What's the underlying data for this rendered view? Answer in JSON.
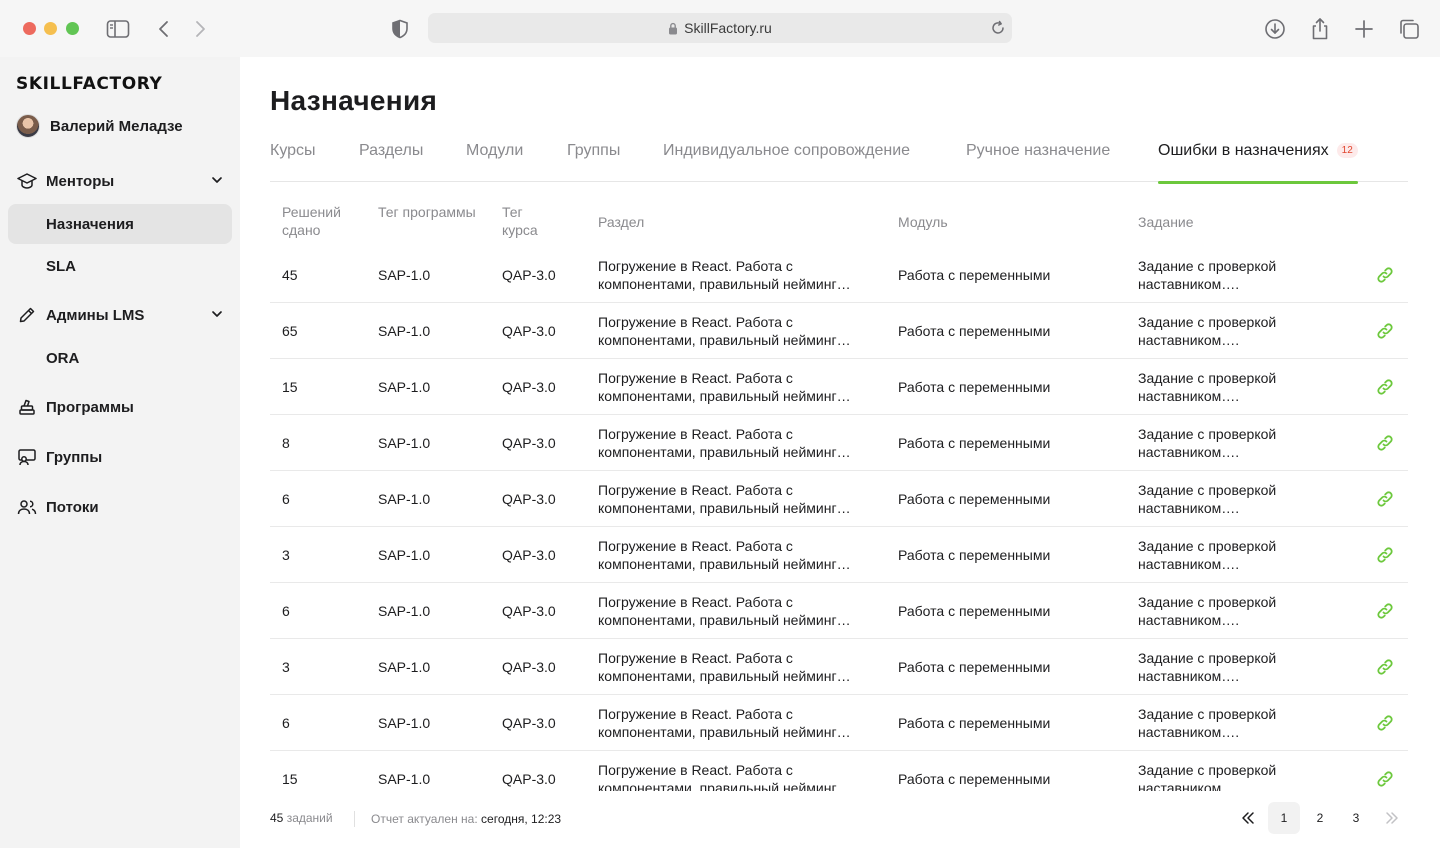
{
  "browser": {
    "url": "SkillFactory.ru"
  },
  "sidebar": {
    "logo": "SKILLFACTORY",
    "user_name": "Валерий Меладзе",
    "sections": {
      "mentors": {
        "label": "Менторы"
      },
      "mentors_items": [
        {
          "label": "Назначения"
        },
        {
          "label": "SLA"
        }
      ],
      "admins": {
        "label": "Админы LMS"
      },
      "admins_items": [
        {
          "label": "ORA"
        }
      ],
      "programs": {
        "label": "Программы"
      },
      "groups": {
        "label": "Группы"
      },
      "streams": {
        "label": "Потоки"
      }
    }
  },
  "main": {
    "title": "Назначения",
    "tabs": [
      {
        "label": "Курсы"
      },
      {
        "label": "Разделы"
      },
      {
        "label": "Модули"
      },
      {
        "label": "Группы"
      },
      {
        "label": "Индивидуальное сопровождение"
      },
      {
        "label": "Ручное назначение"
      },
      {
        "label": "Ошибки в назначениях",
        "badge": "12",
        "active": true
      }
    ],
    "table": {
      "headers": {
        "solved": "Решений сдано",
        "program_tag": "Тег программы",
        "course_tag": "Тег курса",
        "section": "Раздел",
        "module": "Модуль",
        "task": "Задание"
      },
      "rows": [
        {
          "solved": "45",
          "program_tag": "SAP-1.0",
          "course_tag": "QAP-3.0",
          "section": "Погружение в React. Работа с компонентами, правильный нейминг…",
          "module": "Работа с переменными",
          "task": "Задание с проверкой наставником…."
        },
        {
          "solved": "65",
          "program_tag": "SAP-1.0",
          "course_tag": "QAP-3.0",
          "section": "Погружение в React. Работа с компонентами, правильный нейминг…",
          "module": "Работа с переменными",
          "task": "Задание с проверкой наставником…."
        },
        {
          "solved": "15",
          "program_tag": "SAP-1.0",
          "course_tag": "QAP-3.0",
          "section": "Погружение в React. Работа с компонентами, правильный нейминг…",
          "module": "Работа с переменными",
          "task": "Задание с проверкой наставником…."
        },
        {
          "solved": "8",
          "program_tag": "SAP-1.0",
          "course_tag": "QAP-3.0",
          "section": "Погружение в React. Работа с компонентами, правильный нейминг…",
          "module": "Работа с переменными",
          "task": "Задание с проверкой наставником…."
        },
        {
          "solved": "6",
          "program_tag": "SAP-1.0",
          "course_tag": "QAP-3.0",
          "section": "Погружение в React. Работа с компонентами, правильный нейминг…",
          "module": "Работа с переменными",
          "task": "Задание с проверкой наставником…."
        },
        {
          "solved": "3",
          "program_tag": "SAP-1.0",
          "course_tag": "QAP-3.0",
          "section": "Погружение в React. Работа с компонентами, правильный нейминг…",
          "module": "Работа с переменными",
          "task": "Задание с проверкой наставником…."
        },
        {
          "solved": "6",
          "program_tag": "SAP-1.0",
          "course_tag": "QAP-3.0",
          "section": "Погружение в React. Работа с компонентами, правильный нейминг…",
          "module": "Работа с переменными",
          "task": "Задание с проверкой наставником…."
        },
        {
          "solved": "3",
          "program_tag": "SAP-1.0",
          "course_tag": "QAP-3.0",
          "section": "Погружение в React. Работа с компонентами, правильный нейминг…",
          "module": "Работа с переменными",
          "task": "Задание с проверкой наставником…."
        },
        {
          "solved": "6",
          "program_tag": "SAP-1.0",
          "course_tag": "QAP-3.0",
          "section": "Погружение в React. Работа с компонентами, правильный нейминг…",
          "module": "Работа с переменными",
          "task": "Задание с проверкой наставником…."
        },
        {
          "solved": "15",
          "program_tag": "SAP-1.0",
          "course_tag": "QAP-3.0",
          "section": "Погружение в React. Работа с компонентами, правильный нейминг…",
          "module": "Работа с переменными",
          "task": "Задание с проверкой наставником…."
        }
      ]
    },
    "footer": {
      "count_number": "45",
      "count_label": "заданий",
      "report_label": "Отчет актуален на:",
      "report_value": "сегодня, 12:23",
      "pages": [
        "1",
        "2",
        "3"
      ],
      "current_page": "1"
    }
  },
  "colors": {
    "accent_green": "#6cc83c",
    "badge_red": "#e0452e",
    "muted_text": "#8a8a8e"
  },
  "icons": {
    "sidebar_toggle": "sidebar-icon",
    "back": "chevron-left-icon",
    "forward": "chevron-right-icon",
    "shield": "shield-icon",
    "lock": "lock-icon",
    "reload": "reload-icon",
    "download": "download-icon",
    "share": "share-icon",
    "new_tab": "plus-icon",
    "tabs_overview": "tabs-icon",
    "row_action": "link-icon"
  }
}
